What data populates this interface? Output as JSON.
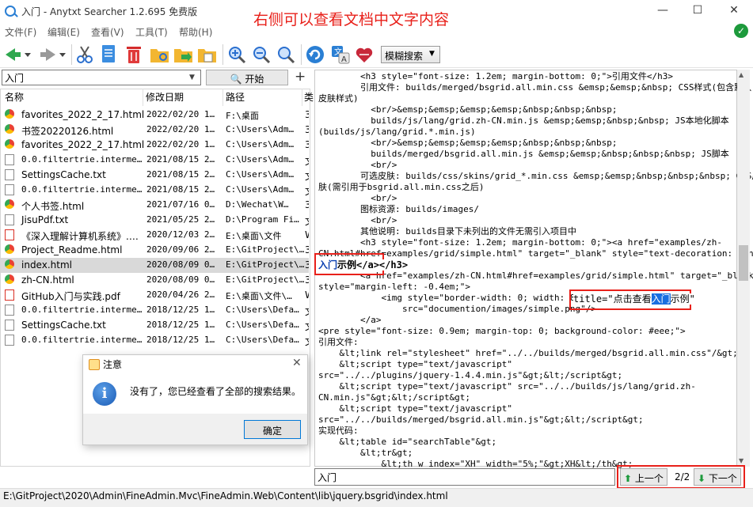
{
  "window": {
    "title": "入门 - Anytxt Searcher 1.2.695 免费版",
    "annotation": "右侧可以查看文档中文字内容",
    "minimize": "—",
    "maximize": "☐",
    "close": "✕"
  },
  "menu": [
    "文件(F)",
    "编辑(E)",
    "查看(V)",
    "工具(T)",
    "帮助(H)"
  ],
  "toolbar": {
    "fuzzy_label": "模糊搜索"
  },
  "search": {
    "query": "入门",
    "start_label": "开始",
    "add_label": "+"
  },
  "list": {
    "columns": [
      "名称",
      "修改日期",
      "路径",
      "类"
    ],
    "rows": [
      {
        "name": "favorites_2022_2_17.html",
        "date": "2022/02/20 1…",
        "path": "F:\\桌面",
        "ext": "3",
        "icon": "chrome-icon"
      },
      {
        "name": "书签20220126.html",
        "date": "2022/02/20 1…",
        "path": "C:\\Users\\Adm…",
        "ext": "3",
        "icon": "chrome-icon"
      },
      {
        "name": "favorites_2022_2_17.html",
        "date": "2022/02/20 1…",
        "path": "C:\\Users\\Adm…",
        "ext": "3",
        "icon": "chrome-icon"
      },
      {
        "name": "0.0.filtertrie.interme…",
        "date": "2021/08/15 2…",
        "path": "C:\\Users\\Adm…",
        "ext": "文",
        "icon": "text-file-icon"
      },
      {
        "name": "SettingsCache.txt",
        "date": "2021/08/15 2…",
        "path": "C:\\Users\\Adm…",
        "ext": "文",
        "icon": "text-file-icon"
      },
      {
        "name": "0.0.filtertrie.interme…",
        "date": "2021/08/15 2…",
        "path": "C:\\Users\\Adm…",
        "ext": "文",
        "icon": "text-file-icon"
      },
      {
        "name": "个人书签.html",
        "date": "2021/07/16 0…",
        "path": "D:\\Wechat\\W…",
        "ext": "3",
        "icon": "chrome-icon"
      },
      {
        "name": "JisuPdf.txt",
        "date": "2021/05/25 2…",
        "path": "D:\\Program Fi…",
        "ext": "文",
        "icon": "text-file-icon"
      },
      {
        "name": "《深入理解计算机系统》.…",
        "date": "2020/12/03 2…",
        "path": "E:\\桌面\\文件",
        "ext": "W",
        "icon": "pdf-icon"
      },
      {
        "name": "Project_Readme.html",
        "date": "2020/09/06 2…",
        "path": "E:\\GitProject\\…",
        "ext": "3",
        "icon": "chrome-icon"
      },
      {
        "name": "index.html",
        "date": "2020/08/09 0…",
        "path": "E:\\GitProject\\…",
        "ext": "3",
        "icon": "chrome-icon",
        "selected": true
      },
      {
        "name": "zh-CN.html",
        "date": "2020/08/09 0…",
        "path": "E:\\GitProject\\…",
        "ext": "3",
        "icon": "chrome-icon"
      },
      {
        "name": "GitHub入门与实践.pdf",
        "date": "2020/04/26 2…",
        "path": "E:\\桌面\\文件\\…",
        "ext": "W",
        "icon": "pdf-icon"
      },
      {
        "name": "0.0.filtertrie.interme…",
        "date": "2018/12/25 1…",
        "path": "C:\\Users\\Defa…",
        "ext": "文",
        "icon": "text-file-icon"
      },
      {
        "name": "SettingsCache.txt",
        "date": "2018/12/25 1…",
        "path": "C:\\Users\\Defa…",
        "ext": "文",
        "icon": "text-file-icon"
      },
      {
        "name": "0.0.filtertrie.interme…",
        "date": "2018/12/25 1…",
        "path": "C:\\Users\\Defa…",
        "ext": "文",
        "icon": "text-file-icon"
      }
    ]
  },
  "dialog": {
    "title": "注意",
    "message": "没有了，您已经查看了全部的搜索结果。",
    "ok_label": "确定",
    "close": "✕",
    "info_glyph": "i"
  },
  "preview": {
    "lines": [
      "        <h3 style=\"font-size: 1.2em; margin-bottom: 0;\">引用文件</h3>",
      "        引用文件: builds/merged/bsgrid.all.min.css &emsp;&emsp;&nbsp; CSS样式(包含默认",
      "皮肤样式)",
      "          <br/>&emsp;&emsp;&emsp;&emsp;&nbsp;&nbsp;&nbsp;",
      "          builds/js/lang/grid.zh-CN.min.js &emsp;&emsp;&nbsp;&nbsp; JS本地化脚本",
      "(builds/js/lang/grid.*.min.js)",
      "          <br/>&emsp;&emsp;&emsp;&emsp;&nbsp;&nbsp;&nbsp;",
      "          builds/merged/bsgrid.all.min.js &emsp;&emsp;&nbsp;&nbsp;&nbsp; JS脚本",
      "          <br/>",
      "        可选皮肤: builds/css/skins/grid_*.min.css &emsp;&emsp;&nbsp;&nbsp;&nbsp; CSS皮",
      "肤(需引用于bsgrid.all.min.css之后)",
      "          <br/>",
      "        图标资源: builds/images/",
      "          <br/>",
      "        其他说明: builds目录下未列出的文件无需引入项目中",
      "        <h3 style=\"font-size: 1.2em; margin-bottom: 0;\"><a href=\"examples/zh-",
      "CN.html#href=examples/grid/simple.html\" target=\"_blank\" style=\"text-decoration: none;\">",
      "",
      "        <a href=\"examples/zh-CN.html#href=examples/grid/simple.html\" target=\"_blank\"",
      "style=\"margin-left: -0.4em;\">",
      "            <img style=\"border-width: 0; width: 88%;\"",
      "                src=\"documention/images/simple.png\"/>",
      "        </a>",
      "<pre style=\"font-size: 0.9em; margin-top: 0; background-color: #eee;\">",
      "引用文件:",
      "    &lt;link rel=\"stylesheet\" href=\"../../builds/merged/bsgrid.all.min.css\"/&gt;",
      "    &lt;script type=\"text/javascript\"",
      "src=\"../../plugins/jquery-1.4.4.min.js\"&gt;&lt;/script&gt;",
      "    &lt;script type=\"text/javascript\" src=\"../../builds/js/lang/grid.zh-",
      "CN.min.js\"&gt;&lt;/script&gt;",
      "    &lt;script type=\"text/javascript\"",
      "src=\"../../builds/merged/bsgrid.all.min.js\"&gt;&lt;/script&gt;",
      "实现代码:",
      "    &lt;table id=\"searchTable\"&gt;",
      "        &lt;tr&gt;",
      "            &lt;th w_index=\"XH\" width=\"5%;\"&gt;XH&lt;/th&gt;"
    ],
    "highlight_a": {
      "term": "入门",
      "rest": "示例</a></h3>"
    },
    "highlight_b": {
      "prefix": "title=\"点击查看",
      "term": "入门",
      "suffix": "示例\""
    }
  },
  "find": {
    "query": "入门",
    "prev_label": "上一个",
    "next_label": "下一个",
    "count": "2/2"
  },
  "status": {
    "path": "E:\\GitProject\\2020\\Admin\\FineAdmin.Mvc\\FineAdmin.Web\\Content\\lib\\jquery.bsgrid\\index.html"
  },
  "colors": {
    "accent_red": "#e8201a",
    "highlight_blue": "#1a6ee0",
    "ok_green": "#1d9a3c"
  }
}
